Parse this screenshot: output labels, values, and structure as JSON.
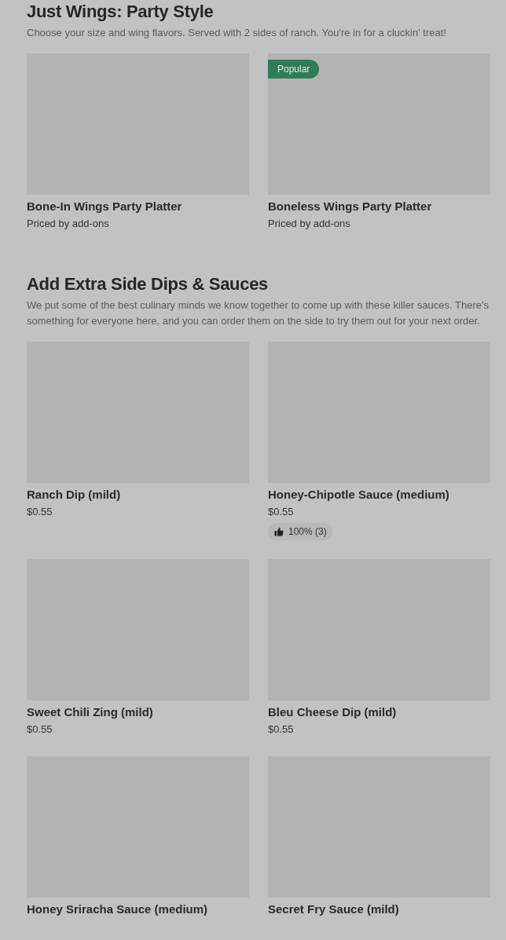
{
  "sections": [
    {
      "title": "Just Wings: Party Style",
      "description": "Choose your size and wing flavors. Served with 2 sides of ranch. You're in for a cluckin' treat!",
      "items": [
        {
          "name": "Bone-In Wings Party Platter",
          "price": "Priced by add-ons"
        },
        {
          "name": "Boneless Wings Party Platter",
          "price": "Priced by add-ons",
          "badge": "Popular"
        }
      ]
    },
    {
      "title": "Add Extra Side Dips & Sauces",
      "description": "We put some of the best culinary minds we know together to come up with these killer sauces. There's something for everyone here, and you can order them on the side to try them out for your next order.",
      "items": [
        {
          "name": "Ranch Dip (mild)",
          "price": "$0.55"
        },
        {
          "name": "Honey-Chipotle Sauce (medium)",
          "price": "$0.55",
          "rating": "100% (3)"
        },
        {
          "name": "Sweet Chili Zing (mild)",
          "price": "$0.55"
        },
        {
          "name": "Bleu Cheese Dip (mild)",
          "price": "$0.55"
        },
        {
          "name": "Honey Sriracha Sauce (medium)"
        },
        {
          "name": "Secret Fry Sauce (mild)"
        }
      ]
    }
  ]
}
